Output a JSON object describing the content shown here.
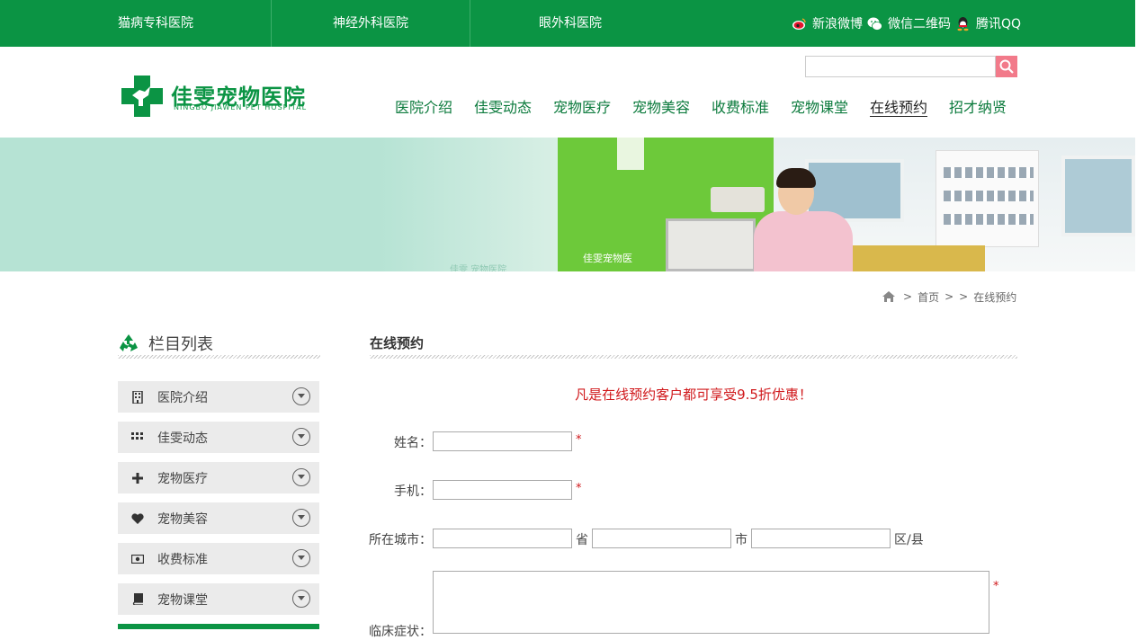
{
  "topbar": {
    "links": [
      "猫病专科医院",
      "神经外科医院",
      "眼外科医院"
    ],
    "social": [
      "新浪微博",
      "微信二维码",
      "腾讯QQ"
    ]
  },
  "logo": {
    "name_cn": "佳雯宠物医院",
    "name_en": "NINGBO JIAWEN PET HOSPITAL"
  },
  "search": {
    "value": ""
  },
  "nav": {
    "items": [
      "医院介绍",
      "佳雯动态",
      "宠物医疗",
      "宠物美容",
      "收费标准",
      "宠物课堂",
      "在线预约",
      "招才纳贤"
    ],
    "active": "在线预约"
  },
  "banner": {
    "sign": "佳雯宠物医",
    "sign_bottom": "佳雯 宠物医院"
  },
  "breadcrumb": {
    "home": "首页",
    "sep": ">",
    "current": "在线预约"
  },
  "sidebar": {
    "title": "栏目列表",
    "items": [
      {
        "label": "医院介绍",
        "icon": "building-icon"
      },
      {
        "label": "佳雯动态",
        "icon": "grid-icon"
      },
      {
        "label": "宠物医疗",
        "icon": "plus-icon"
      },
      {
        "label": "宠物美容",
        "icon": "heart-icon"
      },
      {
        "label": "收费标准",
        "icon": "money-icon"
      },
      {
        "label": "宠物课堂",
        "icon": "book-icon"
      }
    ]
  },
  "form": {
    "title": "在线预约",
    "promo": "凡是在线预约客户都可享受9.5折优惠！",
    "name_label": "姓名：",
    "phone_label": "手机：",
    "city_label": "所在城市：",
    "province_unit": "省",
    "city_unit": "市",
    "district_unit": "区/县",
    "symptom_label": "临床症状：",
    "required_mark": "*"
  },
  "colors": {
    "brand_green": "#0b9444",
    "promo_red": "#d0181b",
    "search_pink": "#f27a8a"
  }
}
